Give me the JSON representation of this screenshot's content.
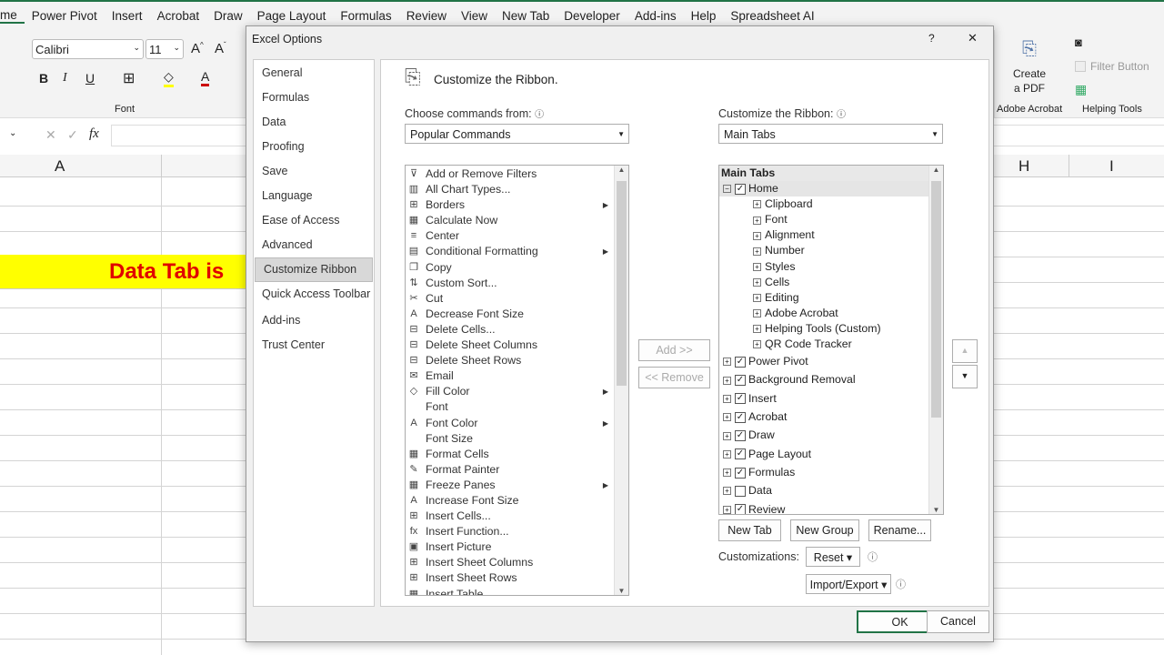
{
  "tabs": [
    "me",
    "Power Pivot",
    "Insert",
    "Acrobat",
    "Draw",
    "Page Layout",
    "Formulas",
    "Review",
    "View",
    "New Tab",
    "Developer",
    "Add-ins",
    "Help",
    "Spreadsheet AI"
  ],
  "ribbon": {
    "font_name": "Calibri",
    "font_size": "11",
    "font_group": "Font",
    "create_pdf_line1": "Create",
    "create_pdf_line2": "a PDF",
    "adobe_group": "Adobe Acrobat",
    "filter_button": "Filter Button",
    "helping_group": "Helping Tools",
    "fx": "fx"
  },
  "sheet": {
    "col_a": "A",
    "col_h": "H",
    "col_i": "I",
    "banner": "Data Tab is",
    "highlight_color": "#ffff00",
    "banner_color": "#e00000"
  },
  "dialog": {
    "title": "Excel Options",
    "help": "?",
    "close": "✕",
    "nav": [
      "General",
      "Formulas",
      "Data",
      "Proofing",
      "Save",
      "Language",
      "Ease of Access",
      "Advanced",
      "Customize Ribbon",
      "Quick Access Toolbar",
      "Add-ins",
      "Trust Center"
    ],
    "heading": "Customize the Ribbon.",
    "choose_label": "Choose commands from:",
    "choose_value": "Popular Commands",
    "customize_label": "Customize the Ribbon:",
    "customize_value": "Main Tabs",
    "commands": [
      {
        "t": "Add or Remove Filters",
        "i": "⊽"
      },
      {
        "t": "All Chart Types...",
        "i": "▥"
      },
      {
        "t": "Borders",
        "i": "⊞",
        "s": 1
      },
      {
        "t": "Calculate Now",
        "i": "▦"
      },
      {
        "t": "Center",
        "i": "≡"
      },
      {
        "t": "Conditional Formatting",
        "i": "▤",
        "s": 1
      },
      {
        "t": "Copy",
        "i": "❐"
      },
      {
        "t": "Custom Sort...",
        "i": "⇅"
      },
      {
        "t": "Cut",
        "i": "✂"
      },
      {
        "t": "Decrease Font Size",
        "i": "A"
      },
      {
        "t": "Delete Cells...",
        "i": "⊟"
      },
      {
        "t": "Delete Sheet Columns",
        "i": "⊟"
      },
      {
        "t": "Delete Sheet Rows",
        "i": "⊟"
      },
      {
        "t": "Email",
        "i": "✉"
      },
      {
        "t": "Fill Color",
        "i": "◇",
        "s": 1
      },
      {
        "t": "Font",
        "i": ""
      },
      {
        "t": "Font Color",
        "i": "A",
        "s": 1
      },
      {
        "t": "Font Size",
        "i": ""
      },
      {
        "t": "Format Cells",
        "i": "▦"
      },
      {
        "t": "Format Painter",
        "i": "✎"
      },
      {
        "t": "Freeze Panes",
        "i": "▦",
        "s": 1
      },
      {
        "t": "Increase Font Size",
        "i": "A"
      },
      {
        "t": "Insert Cells...",
        "i": "⊞"
      },
      {
        "t": "Insert Function...",
        "i": "fx"
      },
      {
        "t": "Insert Picture",
        "i": "▣"
      },
      {
        "t": "Insert Sheet Columns",
        "i": "⊞"
      },
      {
        "t": "Insert Sheet Rows",
        "i": "⊞"
      },
      {
        "t": "Insert Table",
        "i": "▦"
      }
    ],
    "tree_header": "Main Tabs",
    "home": "Home",
    "home_groups": [
      "Clipboard",
      "Font",
      "Alignment",
      "Number",
      "Styles",
      "Cells",
      "Editing",
      "Adobe Acrobat",
      "Helping Tools (Custom)",
      "QR Code Tracker"
    ],
    "tabs": [
      {
        "t": "Power Pivot",
        "c": true
      },
      {
        "t": "Background Removal",
        "c": true
      },
      {
        "t": "Insert",
        "c": true
      },
      {
        "t": "Acrobat",
        "c": true
      },
      {
        "t": "Draw",
        "c": true
      },
      {
        "t": "Page Layout",
        "c": true
      },
      {
        "t": "Formulas",
        "c": true
      },
      {
        "t": "Data",
        "c": false
      },
      {
        "t": "Review",
        "c": true
      }
    ],
    "add": "Add >>",
    "remove": "<< Remove",
    "new_tab": "New Tab",
    "new_group": "New Group",
    "rename": "Rename...",
    "customizations": "Customizations:",
    "reset": "Reset ▾",
    "import_export": "Import/Export ▾",
    "ok": "OK",
    "cancel": "Cancel"
  }
}
